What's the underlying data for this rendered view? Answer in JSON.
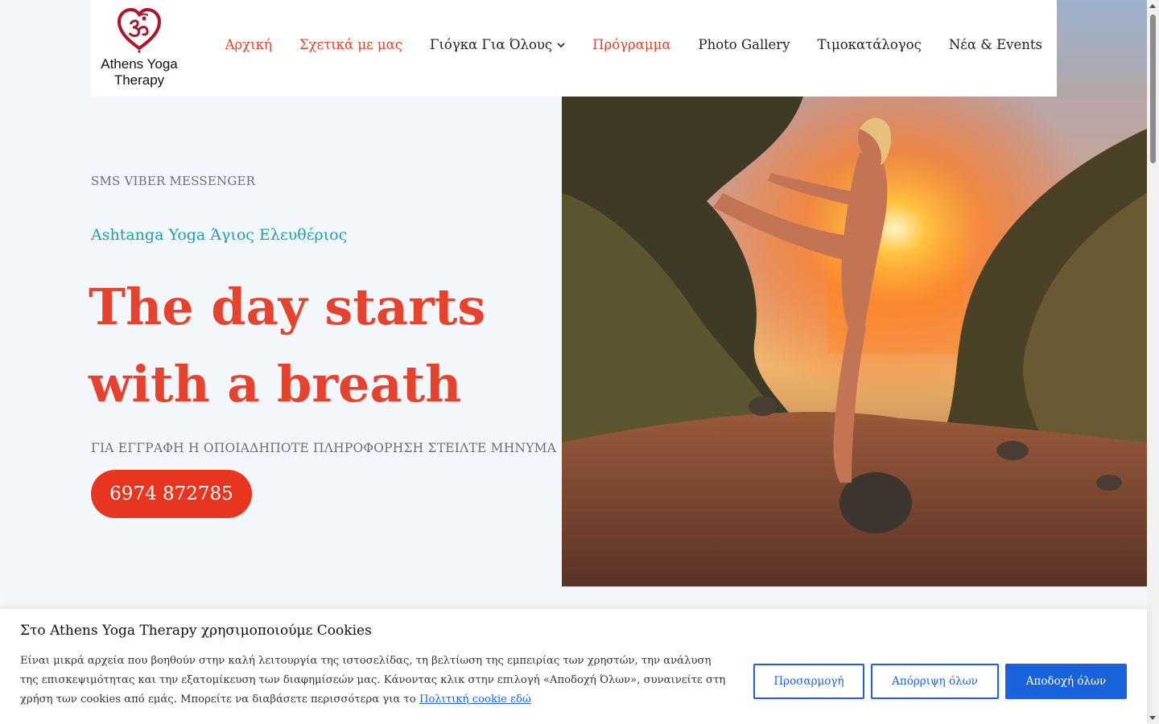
{
  "header": {
    "logo_text_line1": "Athens Yoga",
    "logo_text_line2": "Therapy",
    "nav": [
      {
        "label": "Αρχική",
        "active": true
      },
      {
        "label": "Σχετικά με μας",
        "active": true
      },
      {
        "label": "Γιόγκα Για Όλους",
        "active": false,
        "has_dropdown": true
      },
      {
        "label": "Πρόγραμμα",
        "active": true
      },
      {
        "label": "Photo Gallery",
        "active": false
      },
      {
        "label": "Τιμοκατάλογος",
        "active": false
      },
      {
        "label": "Νέα & Events",
        "active": false
      }
    ]
  },
  "hero": {
    "eyebrow": "SMS VIBER MESSENGER",
    "subtitle": "Ashtanga Yoga Άγιος Ελευθέριος",
    "headline_line1": "The day starts",
    "headline_line2": "with a breath",
    "info": "ΓΙΑ ΕΓΓΡΑΦΗ Η ΟΠΟΙΑΔΗΠΟΤΕ ΠΛΗΡΟΦΟΡΗΣΗ ΣΤΕΙΛΤΕ ΜΗΝΥΜΑ",
    "phone": "6974 872785"
  },
  "cookie": {
    "title": "Στο Athens Yoga Therapy χρησιμοποιούμε Cookies",
    "text": "Είναι μικρά αρχεία που βοηθούν στην καλή λειτουργία της ιστοσελίδας, τη βελτίωση της εμπειρίας των χρηστών, την ανάλυση της επισκεψιμότητας και την εξατομίκευση των διαφημίσεών μας. Κάνοντας κλικ στην επιλογή «Αποδοχή Όλων», συναινείτε στη χρήση των cookies από εμάς. Μπορείτε να διαβάσετε περισσότερα για το ",
    "link": "Πολιτική cookie εδώ",
    "customize": "Προσαρμογή",
    "reject": "Απόρριψη όλων",
    "accept": "Αποδοχή όλων"
  },
  "colors": {
    "accent": "#e5432d",
    "teal": "#18a3b3",
    "cookie_blue": "#1863dc",
    "background": "#f3f6fb"
  }
}
